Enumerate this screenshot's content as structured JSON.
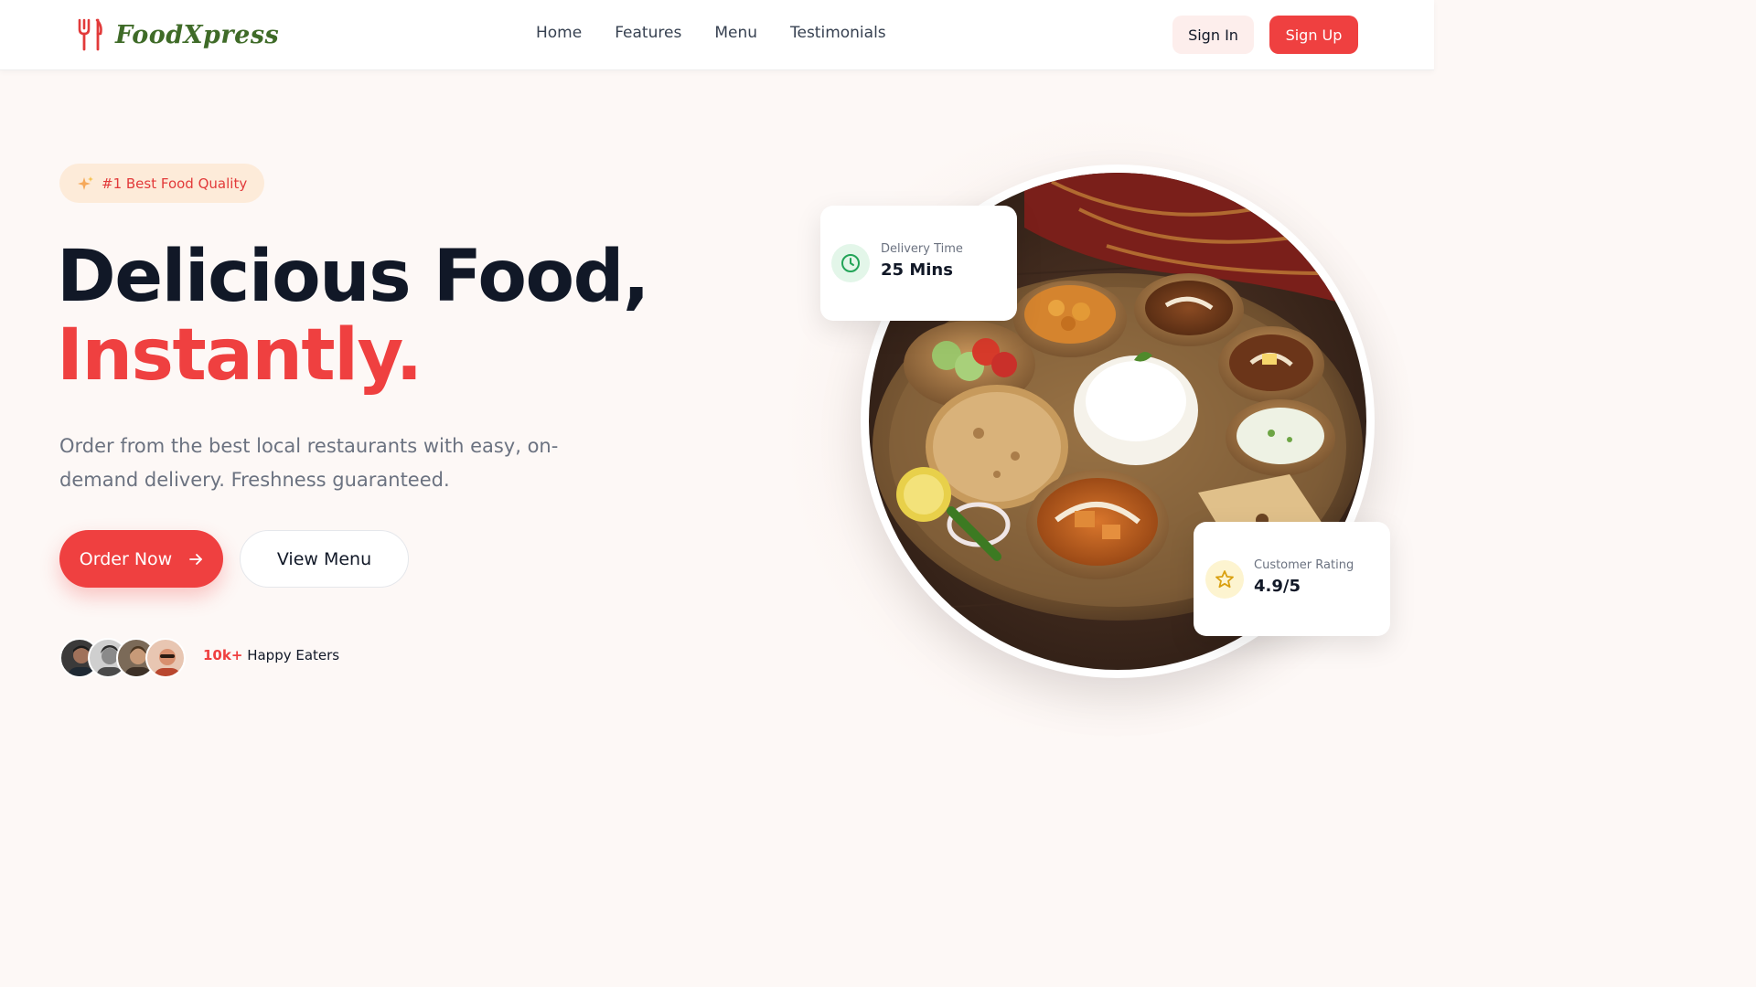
{
  "brand": {
    "name": "FoodXpress",
    "logo_icon": "fork-knife-icon",
    "color": "#3f6b28"
  },
  "nav": {
    "links": [
      "Home",
      "Features",
      "Menu",
      "Testimonials"
    ],
    "sign_in": "Sign In",
    "sign_up": "Sign Up"
  },
  "hero": {
    "badge": {
      "icon": "sparkles-icon",
      "text": "#1 Best Food Quality"
    },
    "title_line1": "Delicious Food,",
    "title_line2": "Instantly.",
    "description": "Order from the best local restaurants with easy, on-demand delivery. Freshness guaranteed.",
    "order_button": "Order Now",
    "order_button_icon": "arrow-right-icon",
    "view_button": "View Menu",
    "social_proof": {
      "count": "10k+",
      "label": "Happy Eaters"
    }
  },
  "cards": {
    "delivery": {
      "icon": "clock-icon",
      "label": "Delivery Time",
      "value": "25 Mins"
    },
    "rating": {
      "icon": "star-icon",
      "label": "Customer Rating",
      "value": "4.9/5"
    }
  },
  "colors": {
    "accent": "#ef4040",
    "text_dark": "#111827",
    "text_muted": "#6b7280"
  }
}
